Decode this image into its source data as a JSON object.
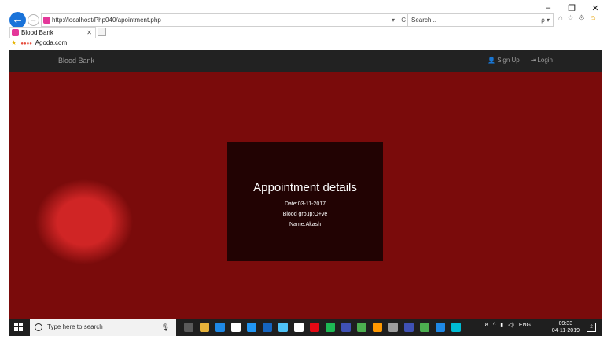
{
  "browser": {
    "window_controls": {
      "minimize": "–",
      "restore": "❐",
      "close": "✕"
    },
    "back_glyph": "←",
    "forward_glyph": "→",
    "address": "http://localhost/Php040/apointment.php",
    "address_controls": "▾ C",
    "search_placeholder": "Search...",
    "search_controls": "ρ ▾",
    "tools": {
      "home": "⌂",
      "favorites": "☆",
      "settings": "⚙",
      "smiley": "☺"
    },
    "tab": {
      "title": "Blood Bank",
      "close": "✕"
    },
    "favorites_bar": {
      "item": "Agoda.com"
    }
  },
  "site": {
    "brand": "Blood Bank",
    "nav": {
      "signup": "Sign Up",
      "login": "Login"
    },
    "details": {
      "title": "Appointment details",
      "date": "Date:03-11-2017",
      "blood_group": "Blood group:O+ve",
      "name": "Name:Akash"
    }
  },
  "taskbar": {
    "search_placeholder": "Type here to search",
    "language": "ENG",
    "time": "09:33",
    "date": "04-11-2019",
    "notifications": "2",
    "icon_colors": [
      "#5a5a5a",
      "#e6b23a",
      "#1e88e5",
      "#ffffff",
      "#2196f3",
      "#1565c0",
      "#4fc3f7",
      "#ffffff",
      "#e50914",
      "#1db954",
      "#3f51b5",
      "#4caf50",
      "#ff9800",
      "#9e9e9e",
      "#3f51b5",
      "#4caf50",
      "#1e88e5",
      "#00bcd4"
    ]
  }
}
